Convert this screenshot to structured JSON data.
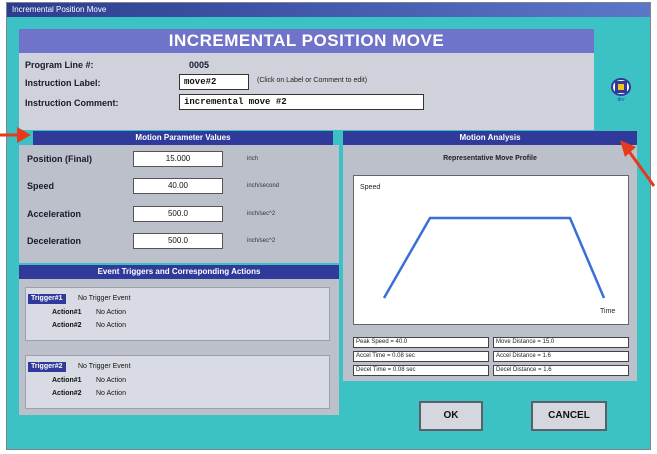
{
  "window": {
    "title": "Incremental Position Move"
  },
  "header": {
    "title": "INCREMENTAL POSITION MOVE",
    "program_line_label": "Program Line #:",
    "program_line_value": "0005",
    "instruction_label_label": "Instruction Label:",
    "instruction_label_value": "move#2",
    "hint": "(Click on Label or Comment to edit)",
    "instruction_comment_label": "Instruction Comment:",
    "instruction_comment_value": "incremental move #2"
  },
  "motion_params": {
    "title": "Motion Parameter Values",
    "rows": [
      {
        "label": "Position (Final)",
        "value": "15.000",
        "unit": "inch"
      },
      {
        "label": "Speed",
        "value": "40.00",
        "unit": "inch/second"
      },
      {
        "label": "Acceleration",
        "value": "500.0",
        "unit": "inch/sec^2"
      },
      {
        "label": "Deceleration",
        "value": "500.0",
        "unit": "inch/sec^2"
      }
    ]
  },
  "events": {
    "title": "Event Triggers and Corresponding Actions",
    "triggers": [
      {
        "tag": "Trigger#1",
        "desc": "No Trigger Event",
        "actions": [
          {
            "label": "Action#1",
            "value": "No Action"
          },
          {
            "label": "Action#2",
            "value": "No Action"
          }
        ]
      },
      {
        "tag": "Trigger#2",
        "desc": "No Trigger Event",
        "actions": [
          {
            "label": "Action#1",
            "value": "No Action"
          },
          {
            "label": "Action#2",
            "value": "No Action"
          }
        ]
      }
    ]
  },
  "analysis": {
    "title": "Motion Analysis",
    "profile_title": "Representative Move Profile",
    "y_label": "Speed",
    "x_label": "Time",
    "readouts": [
      "Peak Speed = 40.0",
      "Move Distance = 15.0",
      "Accel Time = 0.08 sec",
      "Accel Distance = 1.6",
      "Decel Time = 0.08 sec",
      "Decel Distance = 1.6"
    ]
  },
  "buttons": {
    "ok": "OK",
    "cancel": "CANCEL"
  },
  "colors": {
    "accent_teal": "#3cc1c4",
    "banner": "#6f73c9",
    "section_bar": "#2f3a9a",
    "arrow": "#e63a1c",
    "profile_line": "#3a6fd8"
  },
  "icons": {
    "logo": "motion-drive-logo-icon"
  }
}
